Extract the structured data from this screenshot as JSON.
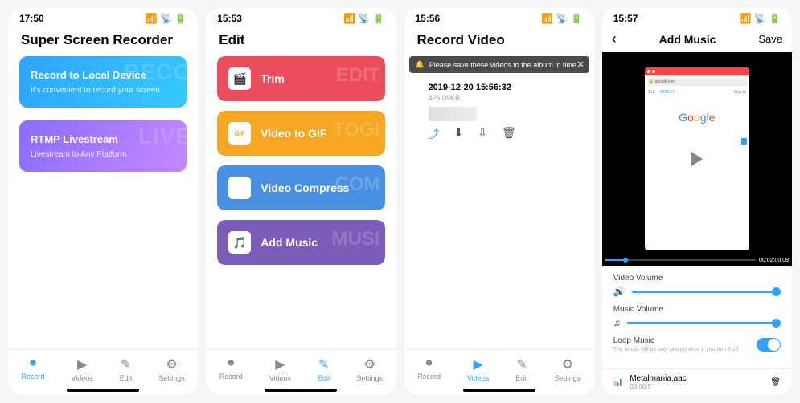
{
  "status": {
    "t1": "17:50",
    "t2": "15:53",
    "t3": "15:56",
    "t4": "15:57"
  },
  "s1": {
    "title": "Super Screen Recorder",
    "card1": {
      "title": "Record to Local Device",
      "sub": "It's convenient to record your screen",
      "ghost": "RECO"
    },
    "card2": {
      "title": "RTMP Livestream",
      "sub": "Livestream to Any Platform",
      "ghost": "LIVE"
    }
  },
  "s2": {
    "title": "Edit",
    "items": [
      {
        "label": "Trim",
        "ghost": "EDIT"
      },
      {
        "label": "Video to GIF",
        "ghost": "TOGI"
      },
      {
        "label": "Video Compress",
        "ghost": "COM"
      },
      {
        "label": "Add Music",
        "ghost": "MUSI"
      }
    ]
  },
  "s3": {
    "title": "Record Video",
    "banner": "Please save these videos to the album in time",
    "video": {
      "ts": "2019-12-20 15:56:32",
      "size": "426.09KB"
    }
  },
  "s4": {
    "title": "Add Music",
    "save": "Save",
    "url": "google.com",
    "time": "00:02:00:09",
    "vv": "Video Volume",
    "mv": "Music Volume",
    "loop": "Loop Music",
    "loopHint": "The music will be only played once if you turn it off",
    "track": "Metalmania.aac",
    "trackTime": "00:00:5"
  },
  "tabs": {
    "record": "Record",
    "videos": "Videos",
    "edit": "Edit",
    "settings": "Settings"
  }
}
